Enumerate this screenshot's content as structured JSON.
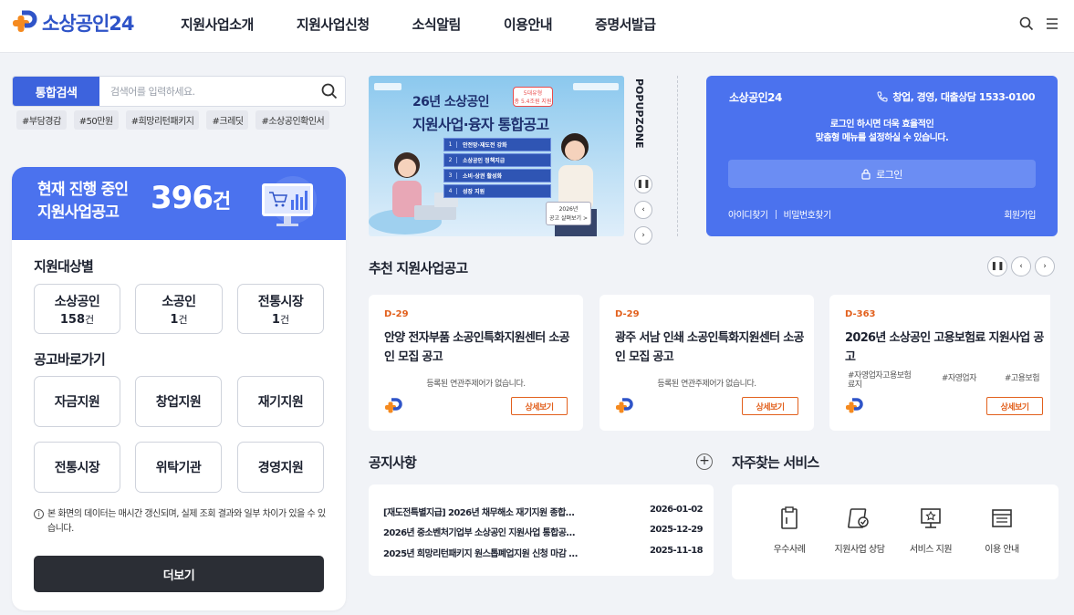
{
  "header": {
    "logo_text": "소상공인24",
    "nav": [
      "지원사업소개",
      "지원사업신청",
      "소식알림",
      "이용안내",
      "증명서발급"
    ],
    "icons": [
      "search-icon",
      "menu-icon"
    ]
  },
  "search": {
    "label": "통합검색",
    "placeholder": "검색어를 입력하세요.",
    "tags": [
      "#부담경감",
      "#50만원",
      "#희망리턴패키지",
      "#크레딧",
      "#소상공인확인서"
    ]
  },
  "summary": {
    "title_line1": "현재 진행 중인",
    "title_line2": "지원사업공고",
    "count": "396",
    "count_unit": "건",
    "target_title": "지원대상별",
    "targets": [
      {
        "label": "소상공인",
        "count": "158",
        "unit": "건"
      },
      {
        "label": "소공인",
        "count": "1",
        "unit": "건"
      },
      {
        "label": "전통시장",
        "count": "1",
        "unit": "건"
      }
    ],
    "shortcut_title": "공고바로가기",
    "shortcuts": [
      "자금지원",
      "창업지원",
      "재기지원",
      "전통시장",
      "위탁기관",
      "경영지원"
    ],
    "notice": "본 화면의 데이터는 매시간 갱신되며, 실제 조회 결과와 일부 차이가 있을 수 있습니다.",
    "more_label": "더보기"
  },
  "banner": {
    "title_line1": "26년 소상공인",
    "title_line2": "지원사업·융자 통합공고",
    "badge_line1": "5대유형",
    "badge_line2": "총 5.4조원 지원",
    "items": [
      "안전망·재도전 강화",
      "소상공인 정책지급",
      "소비·상권 활성화",
      "성장 지원"
    ],
    "card_line1": "2026년",
    "card_line2": "공고 살펴보기 >",
    "popupzone_label": "POPUPZONE"
  },
  "login": {
    "title": "소상공인24",
    "phone": "창업, 경영, 대출상담 1533-0100",
    "message_line1": "로그인 하시면 더욱 효율적인",
    "message_line2": "맞춤형 메뉴를 설정하실 수 있습니다.",
    "button": "로그인",
    "find_id": "아이디찾기",
    "find_pw": "비밀번호찾기",
    "join": "회원가입"
  },
  "recommend": {
    "title": "추천 지원사업공고",
    "cards": [
      {
        "dday": "D-29",
        "title": "안양 전자부품 소공인특화지원센터 소공인 모집 공고",
        "sub": "등록된 연관주제어가 없습니다.",
        "button": "상세보기"
      },
      {
        "dday": "D-29",
        "title": "광주 서남 인쇄 소공인특화지원센터 소공인 모집 공고",
        "sub": "등록된 연관주제어가 없습니다.",
        "button": "상세보기"
      },
      {
        "dday": "D-363",
        "title": "2026년 소상공인 고용보험료 지원사업 공고",
        "tags": [
          "#자영업자고용보험료지",
          "#자영업자",
          "#고용보험"
        ],
        "button": "상세보기"
      }
    ]
  },
  "notices": {
    "title": "공지사항",
    "items": [
      {
        "title": "[재도전특별지급] 2026년 채무해소 재기지원 종합…",
        "date": "2026-01-02"
      },
      {
        "title": "2026년 중소벤처기업부 소상공인 지원사업 통합공…",
        "date": "2025-12-29"
      },
      {
        "title": "2025년 희망리턴패키지 원스톱폐업지원 신청 마감 …",
        "date": "2025-11-18"
      }
    ]
  },
  "services": {
    "title": "자주찾는 서비스",
    "items": [
      "우수사례",
      "지원사업 상담",
      "서비스 지원",
      "이용 안내"
    ]
  },
  "colors": {
    "primary": "#4b72ee",
    "accent": "#e2601d",
    "logo_orange": "#f58a1f"
  }
}
